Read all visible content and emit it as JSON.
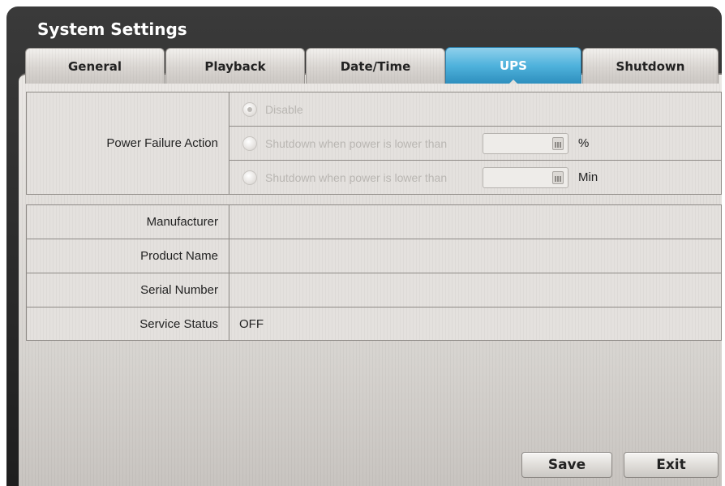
{
  "window": {
    "title": "System Settings"
  },
  "tabs": [
    {
      "label": "General",
      "active": false
    },
    {
      "label": "Playback",
      "active": false
    },
    {
      "label": "Date/Time",
      "active": false
    },
    {
      "label": "UPS",
      "active": true
    },
    {
      "label": "Shutdown",
      "active": false
    }
  ],
  "power_failure": {
    "label": "Power Failure Action",
    "options": [
      {
        "label": "Disable",
        "selected": true
      },
      {
        "label": "Shutdown when power is lower than",
        "value": "",
        "unit": "%",
        "selected": false
      },
      {
        "label": "Shutdown when power is lower than",
        "value": "",
        "unit": "Min",
        "selected": false
      }
    ]
  },
  "ups_info": [
    {
      "label": "Manufacturer",
      "value": ""
    },
    {
      "label": "Product Name",
      "value": ""
    },
    {
      "label": "Serial Number",
      "value": ""
    },
    {
      "label": "Service Status",
      "value": "OFF"
    }
  ],
  "buttons": {
    "save": "Save",
    "exit": "Exit"
  },
  "icons": {
    "radio": "radio-button-icon",
    "keyboard": "keyboard-icon"
  },
  "colors": {
    "active_tab": "#4fb2dc",
    "title": "#ffffff",
    "disabled_text": "#b9b6b2"
  }
}
